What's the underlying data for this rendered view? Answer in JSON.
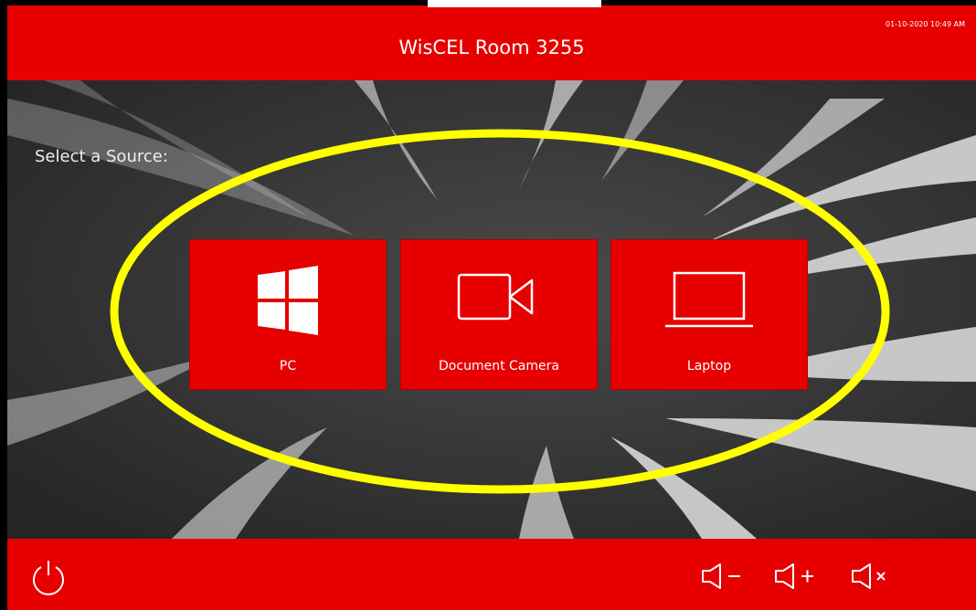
{
  "header": {
    "title": "WisCEL Room 3255",
    "datetime": "01-10-2020 10:49 AM"
  },
  "main": {
    "prompt": "Select a Source:",
    "sources": [
      {
        "label": "PC",
        "icon": "windows-icon"
      },
      {
        "label": "Document Camera",
        "icon": "video-camera-icon"
      },
      {
        "label": "Laptop",
        "icon": "laptop-icon"
      }
    ]
  },
  "footer": {
    "power_icon": "power-icon",
    "volume_down_icon": "volume-down-icon",
    "volume_up_icon": "volume-up-icon",
    "mute_icon": "mute-icon"
  },
  "colors": {
    "brand_red": "#e60000",
    "highlight_yellow": "#ffff00",
    "background_dark": "#3b3b3b"
  }
}
